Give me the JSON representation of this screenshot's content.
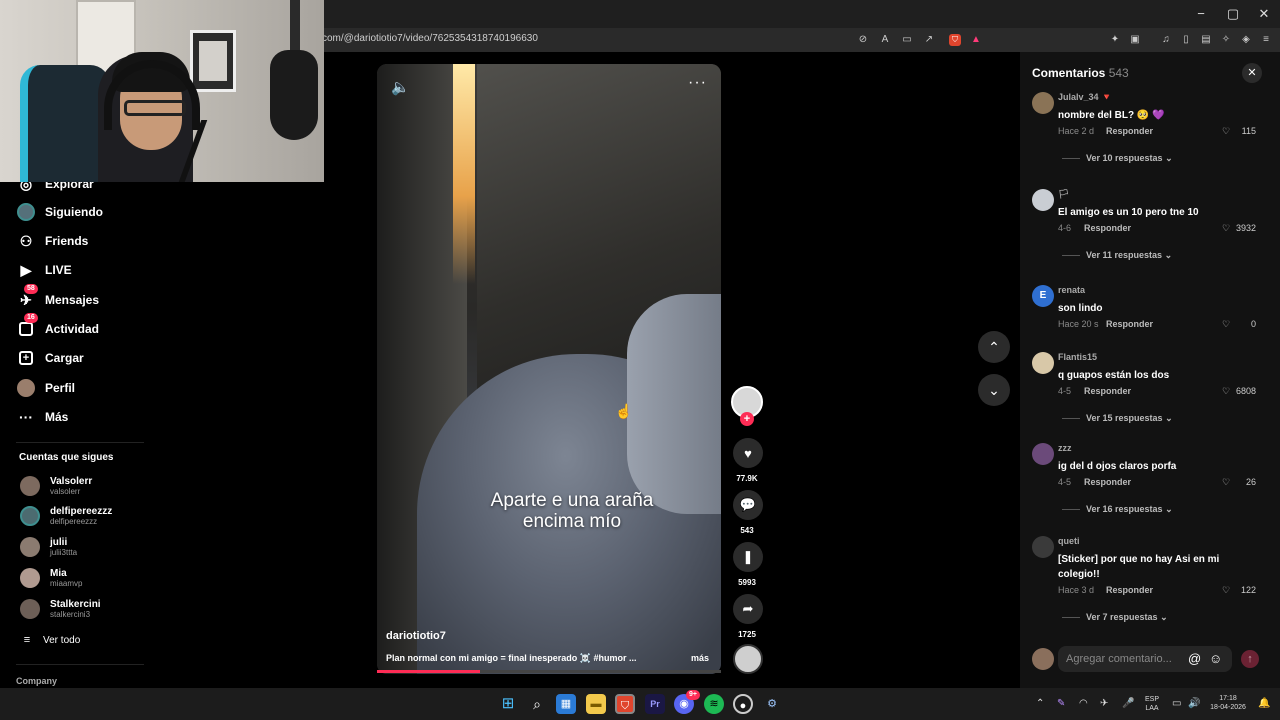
{
  "browser": {
    "url": "com/@dariotiotio7/video/7625354318740196630",
    "window_controls": {
      "minimize": "−",
      "maximize": "▢",
      "close": "✕"
    }
  },
  "sidebar": {
    "items": [
      {
        "label": "Explorar",
        "icon": "compass-icon",
        "glyph": "◎"
      },
      {
        "label": "Siguiendo",
        "icon": "following-avatar-icon",
        "glyph": ""
      },
      {
        "label": "Friends",
        "icon": "friends-icon",
        "glyph": "👥"
      },
      {
        "label": "LIVE",
        "icon": "live-icon",
        "glyph": "▶"
      },
      {
        "label": "Mensajes",
        "icon": "messages-icon",
        "glyph": "✈",
        "badge": "58"
      },
      {
        "label": "Actividad",
        "icon": "activity-icon",
        "glyph": "▢",
        "badge": "16"
      },
      {
        "label": "Cargar",
        "icon": "upload-icon",
        "glyph": "+"
      },
      {
        "label": "Perfil",
        "icon": "profile-icon",
        "glyph": ""
      },
      {
        "label": "Más",
        "icon": "more-icon",
        "glyph": "···"
      }
    ],
    "following_title": "Cuentas que sigues",
    "following": [
      {
        "name": "Valsolerr",
        "handle": "valsolerr"
      },
      {
        "name": "delfipereezzz",
        "handle": "delfipereezzz"
      },
      {
        "name": "julii",
        "handle": "julii3ttta"
      },
      {
        "name": "Mia",
        "handle": "miaamvp"
      },
      {
        "name": "Stalkercini",
        "handle": "stalkercini3"
      }
    ],
    "see_all": "Ver todo",
    "company": "Company"
  },
  "video": {
    "caption": "Aparte e una araña encima mío",
    "author": "dariotiotio7",
    "description": "Plan normal con mi amigo = final inesperado ☠️ #humor ...",
    "more": "más",
    "progress": 0.3
  },
  "actions": {
    "likes": "77.9K",
    "comments": "543",
    "saves": "5993",
    "shares": "1725"
  },
  "comments_panel": {
    "title": "Comentarios",
    "count": "543",
    "input_placeholder": "Agregar comentario...",
    "reply_label": "Responder",
    "items": [
      {
        "user": "Julalv_34 🔻",
        "text": "nombre del BL? 🥺 💜",
        "time": "Hace 2 d",
        "likes": "115",
        "more": "Ver 10 respuestas",
        "avatar": "#8a7356"
      },
      {
        "user": "🏳",
        "text": "El amigo es un 10 pero tne 10",
        "time": "4-6",
        "likes": "3932",
        "more": "Ver 11 respuestas",
        "avatar": "#c9cdd3"
      },
      {
        "user": "renata",
        "text": "son lindo",
        "time": "Hace 20 s",
        "likes": "0",
        "more": "",
        "avatar": "#2f6fd1",
        "initial": "E"
      },
      {
        "user": "Flantis15",
        "text": "q guapos están los dos",
        "time": "4-5",
        "likes": "6808",
        "more": "Ver 15 respuestas",
        "avatar": "#d8c8a8"
      },
      {
        "user": "zzz",
        "text": "ig del d ojos claros porfa",
        "time": "4-5",
        "likes": "26",
        "more": "Ver 16 respuestas",
        "avatar": "#6b4a7a"
      },
      {
        "user": "queti",
        "text": "[Sticker] por que no hay Asi en mi colegio!!",
        "time": "Hace 3 d",
        "likes": "122",
        "more": "Ver 7 respuestas",
        "avatar": "#3a3a3a"
      }
    ]
  },
  "taskbar": {
    "lang": "ESP",
    "layout": "LAA",
    "time": "17:18",
    "date": "18-04-2026",
    "discord_badge": "9+"
  }
}
